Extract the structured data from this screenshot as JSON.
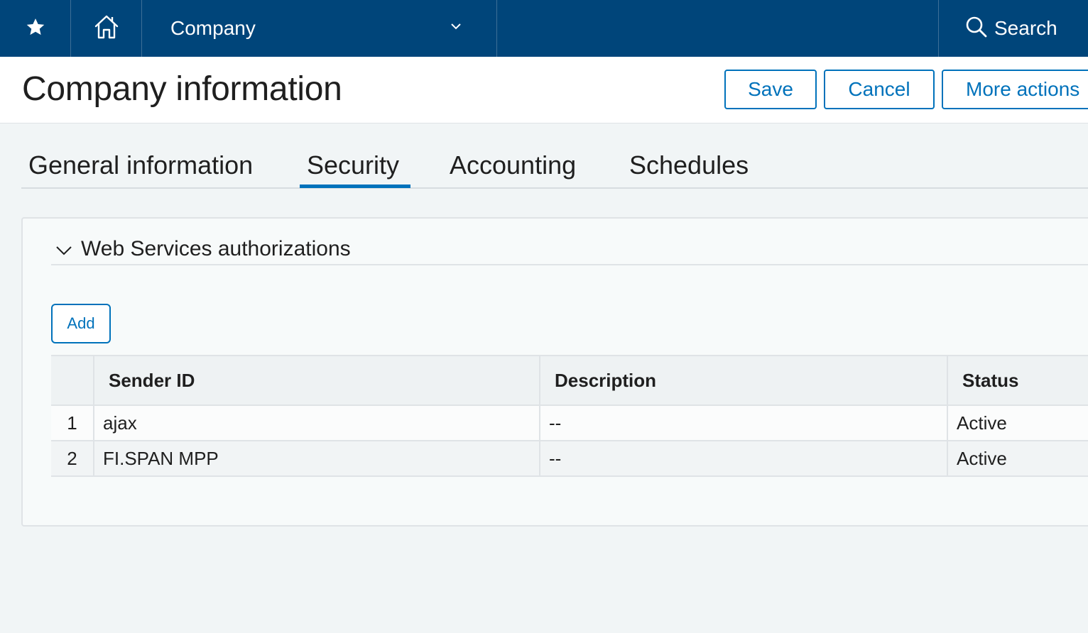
{
  "topbar": {
    "module_label": "Company",
    "search_label": "Search"
  },
  "header": {
    "title": "Company information",
    "save_label": "Save",
    "cancel_label": "Cancel",
    "more_actions_label": "More actions"
  },
  "tabs": [
    {
      "label": "General information",
      "active": false
    },
    {
      "label": "Security",
      "active": true
    },
    {
      "label": "Accounting",
      "active": false
    },
    {
      "label": "Schedules",
      "active": false
    }
  ],
  "section": {
    "title": "Web Services authorizations",
    "add_label": "Add"
  },
  "table": {
    "columns": [
      "",
      "Sender ID",
      "Description",
      "Status"
    ],
    "rows": [
      {
        "num": "1",
        "sender_id": "ajax",
        "description": "--",
        "status": "Active"
      },
      {
        "num": "2",
        "sender_id": "FI.SPAN MPP",
        "description": "--",
        "status": "Active"
      }
    ]
  },
  "colors": {
    "topbar": "#00457a",
    "accent": "#0072bb",
    "background": "#f1f5f6"
  },
  "icons": [
    "star-icon",
    "home-icon",
    "chevron-down-icon",
    "search-icon",
    "collapse-chevron-icon"
  ]
}
